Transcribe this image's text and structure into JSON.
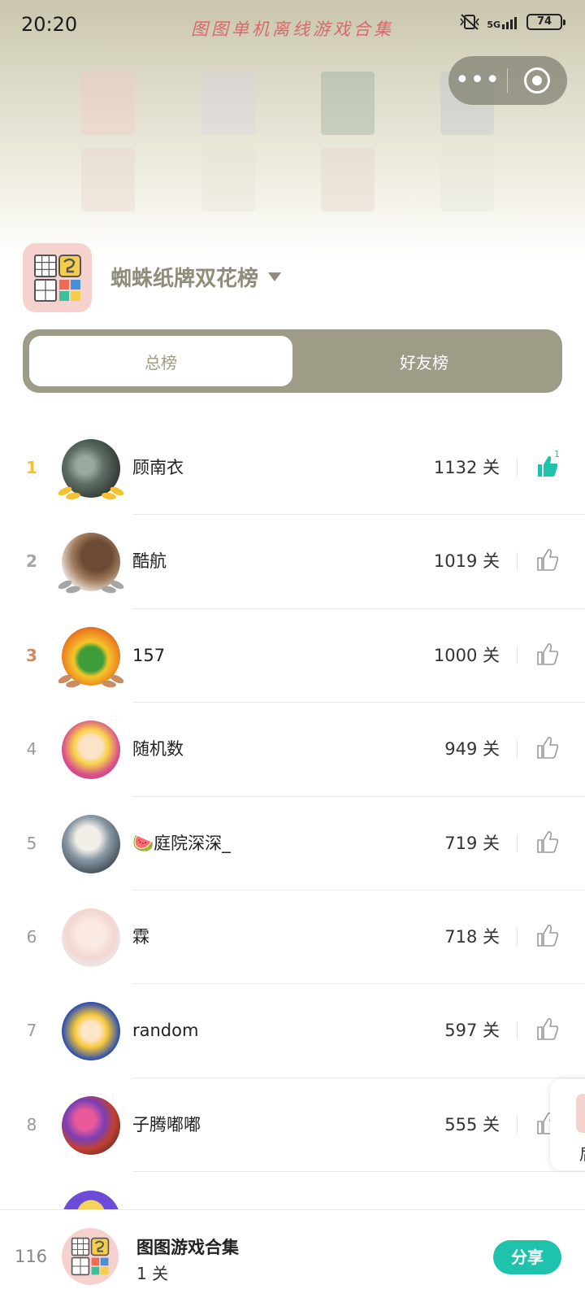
{
  "status_bar": {
    "time": "20:20",
    "network": "5G",
    "battery": "74"
  },
  "banner": {
    "title": "图图单机离线游戏合集"
  },
  "capsule": {
    "more_label": "•••",
    "more_icon": "more-dots-icon",
    "close_icon": "target-circle-icon"
  },
  "game": {
    "title": "蜘蛛纸牌双花榜",
    "logo_icon": "sudoku-grid-logo-icon"
  },
  "tabs": [
    {
      "label": "总榜",
      "active": true
    },
    {
      "label": "好友榜",
      "active": false
    }
  ],
  "leaderboard": [
    {
      "rank": "1",
      "name": "顾南衣",
      "score": "1132 关",
      "likes": "1",
      "liked": true,
      "medal": "gold"
    },
    {
      "rank": "2",
      "name": "酷航",
      "score": "1019 关",
      "liked": false,
      "medal": "silver"
    },
    {
      "rank": "3",
      "name": "157",
      "score": "1000 关",
      "liked": false,
      "medal": "bronze"
    },
    {
      "rank": "4",
      "name": "随机数",
      "score": "949 关",
      "liked": false
    },
    {
      "rank": "5",
      "name": "🍉庭院深深_",
      "score": "719 关",
      "liked": false
    },
    {
      "rank": "6",
      "name": "霖",
      "score": "718 关",
      "liked": false
    },
    {
      "rank": "7",
      "name": "random",
      "score": "597 关",
      "liked": false
    },
    {
      "rank": "8",
      "name": "子腾嘟嘟",
      "score": "555 关",
      "liked": false
    }
  ],
  "side_card": {
    "text": "后"
  },
  "my_rank": {
    "rank": "116",
    "name": "图图游戏合集",
    "score": "1 关",
    "share_label": "分享"
  },
  "colors": {
    "accent": "#1fc3ad",
    "tab_bg": "#9e9b86",
    "gold": "#f2c230",
    "silver": "#a5a5a5",
    "bronze": "#c98b61"
  }
}
